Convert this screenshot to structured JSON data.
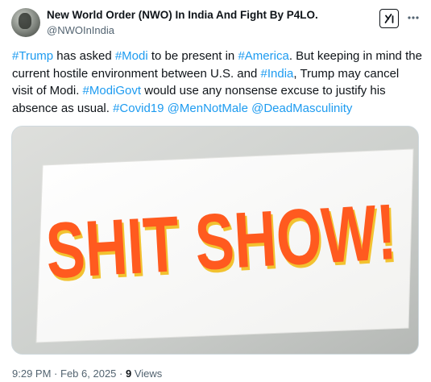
{
  "author": {
    "display_name": "New World Order (NWO) In India And Fight By P4LO.",
    "handle": "@NWOInIndia"
  },
  "tweet": {
    "segments": [
      {
        "text": "#Trump",
        "type": "hashtag"
      },
      {
        "text": " has asked ",
        "type": "text"
      },
      {
        "text": "#Modi",
        "type": "hashtag"
      },
      {
        "text": " to be present in ",
        "type": "text"
      },
      {
        "text": "#America",
        "type": "hashtag"
      },
      {
        "text": ". But keeping in mind the current hostile environment between U.S. and ",
        "type": "text"
      },
      {
        "text": "#India",
        "type": "hashtag"
      },
      {
        "text": ", Trump may cancel visit of Modi. ",
        "type": "text"
      },
      {
        "text": "#ModiGovt",
        "type": "hashtag"
      },
      {
        "text": " would use any nonsense excuse to justify his absence as usual. ",
        "type": "text"
      },
      {
        "text": "#Covid19",
        "type": "hashtag"
      },
      {
        "text": " ",
        "type": "text"
      },
      {
        "text": "@MenNotMale",
        "type": "mention"
      },
      {
        "text": " ",
        "type": "text"
      },
      {
        "text": "@DeadMasculinity",
        "type": "mention"
      }
    ]
  },
  "media": {
    "sign_text": "SHIT SHOW!",
    "colors": {
      "letter_fill": "#ff5a1f",
      "letter_shadow": "#f2c230",
      "card": "#fbfbfa"
    }
  },
  "meta": {
    "time": "9:29 PM",
    "date": "Feb 6, 2025",
    "separator": "·",
    "views_count": "9",
    "views_label": "Views"
  },
  "icons": {
    "grok": "grok-icon",
    "more": "more-horizontal-icon"
  },
  "colors": {
    "link": "#1d9bf0",
    "secondary_text": "#536471",
    "primary_text": "#0f1419"
  }
}
